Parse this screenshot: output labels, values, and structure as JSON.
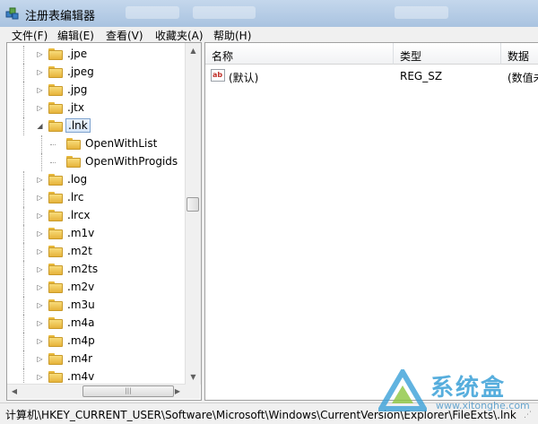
{
  "window": {
    "title": "注册表编辑器"
  },
  "menu": [
    {
      "label": "文件(F)"
    },
    {
      "label": "编辑(E)"
    },
    {
      "label": "查看(V)"
    },
    {
      "label": "收藏夹(A)"
    },
    {
      "label": "帮助(H)"
    }
  ],
  "tree": {
    "items": [
      {
        "label": ".jpe",
        "level": 0,
        "expander": "collapsed"
      },
      {
        "label": ".jpeg",
        "level": 0,
        "expander": "collapsed"
      },
      {
        "label": ".jpg",
        "level": 0,
        "expander": "collapsed"
      },
      {
        "label": ".jtx",
        "level": 0,
        "expander": "collapsed"
      },
      {
        "label": ".lnk",
        "level": 0,
        "expander": "expanded",
        "selected": true
      },
      {
        "label": "OpenWithList",
        "level": 1,
        "expander": "none"
      },
      {
        "label": "OpenWithProgids",
        "level": 1,
        "expander": "none"
      },
      {
        "label": ".log",
        "level": 0,
        "expander": "collapsed"
      },
      {
        "label": ".lrc",
        "level": 0,
        "expander": "collapsed"
      },
      {
        "label": ".lrcx",
        "level": 0,
        "expander": "collapsed"
      },
      {
        "label": ".m1v",
        "level": 0,
        "expander": "collapsed"
      },
      {
        "label": ".m2t",
        "level": 0,
        "expander": "collapsed"
      },
      {
        "label": ".m2ts",
        "level": 0,
        "expander": "collapsed"
      },
      {
        "label": ".m2v",
        "level": 0,
        "expander": "collapsed"
      },
      {
        "label": ".m3u",
        "level": 0,
        "expander": "collapsed"
      },
      {
        "label": ".m4a",
        "level": 0,
        "expander": "collapsed"
      },
      {
        "label": ".m4p",
        "level": 0,
        "expander": "collapsed"
      },
      {
        "label": ".m4r",
        "level": 0,
        "expander": "collapsed"
      },
      {
        "label": ".m4v",
        "level": 0,
        "expander": "collapsed"
      }
    ]
  },
  "list": {
    "columns": [
      "名称",
      "类型",
      "数据"
    ],
    "rows": [
      {
        "name": "(默认)",
        "type": "REG_SZ",
        "data": "(数值未"
      }
    ]
  },
  "icons": {
    "app": "registry-editor-icon",
    "folder": "folder-icon",
    "value": "string-value-icon",
    "ab_text": "ab"
  },
  "status": {
    "path": "计算机\\HKEY_CURRENT_USER\\Software\\Microsoft\\Windows\\CurrentVersion\\Explorer\\FileExts\\.lnk"
  },
  "watermark": {
    "text": "系统盒",
    "sub": "www.xitonghe.com"
  },
  "colors": {
    "folder": "#f2c94c",
    "selection": "#d6e6f8",
    "watermark": "#3aa0d8"
  }
}
